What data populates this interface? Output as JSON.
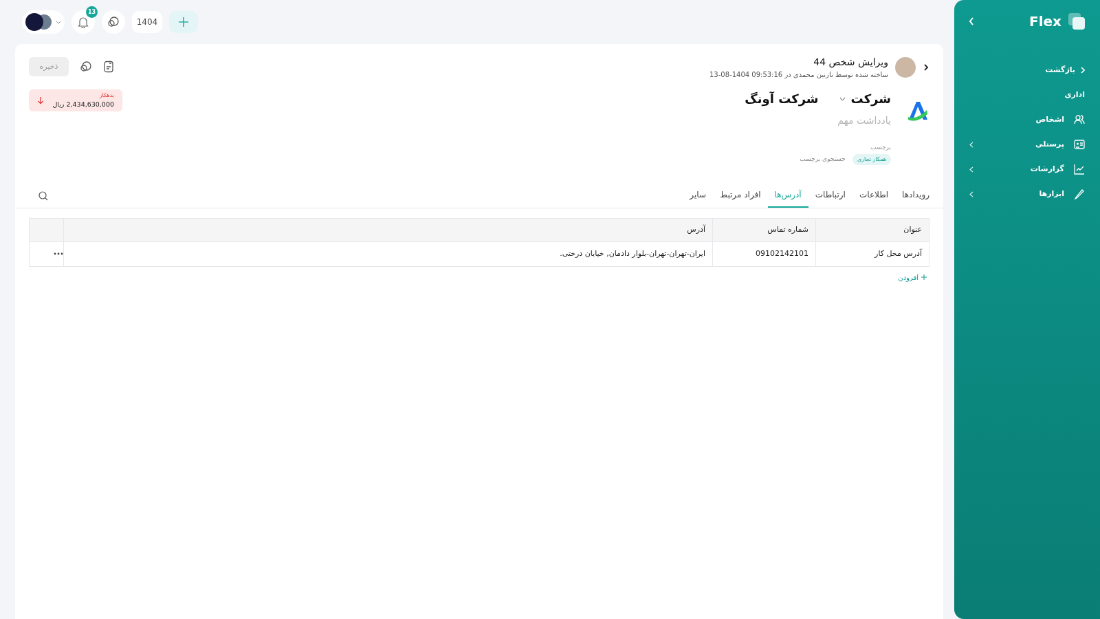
{
  "topbar": {
    "notifications": "13",
    "year": "1404"
  },
  "sidebar": {
    "logo": "Flex",
    "items": [
      {
        "kind": "back",
        "label": "بازگشت"
      },
      {
        "kind": "section",
        "label": "اداری"
      },
      {
        "kind": "nav",
        "label": "اشخاص",
        "has_submenu": false
      },
      {
        "kind": "nav",
        "label": "پرسنلی",
        "has_submenu": true
      },
      {
        "kind": "nav",
        "label": "گزارشات",
        "has_submenu": true
      },
      {
        "kind": "nav",
        "label": "ابزارها",
        "has_submenu": true
      }
    ]
  },
  "header": {
    "title": "ویرایش شخص 44",
    "subtitle": "ساخته شده توسط نازنین محمدی در 09:53:16 1404-08-13",
    "save_button": {
      "label": "ذخیره",
      "disabled": true
    }
  },
  "balance": {
    "label": "بدهکار",
    "amount": "2,434,630,000 ریال"
  },
  "company": {
    "type": "شرکت",
    "name": "شرکت آونگ",
    "note_placeholder": "یادداشت مهم"
  },
  "tags": {
    "label": "برچسب",
    "items": [
      "همکار تجاری"
    ],
    "search_placeholder": "جستجوی برچسب"
  },
  "tabs": [
    {
      "label": "رویدادها",
      "selected": false
    },
    {
      "label": "اطلاعات",
      "selected": false
    },
    {
      "label": "ارتباطات",
      "selected": false
    },
    {
      "label": "آدرس‌ها",
      "selected": true
    },
    {
      "label": "افراد مرتبط",
      "selected": false
    },
    {
      "label": "سایر",
      "selected": false
    }
  ],
  "table": {
    "columns": [
      "عنوان",
      "شماره تماس",
      "آدرس"
    ],
    "rows": [
      {
        "cells": [
          "آدرس محل کار",
          "09102142101",
          "ایران-تهران-تهران-بلوار دادمان, خیابان درختی."
        ]
      }
    ]
  },
  "add_button": "افزودن"
}
